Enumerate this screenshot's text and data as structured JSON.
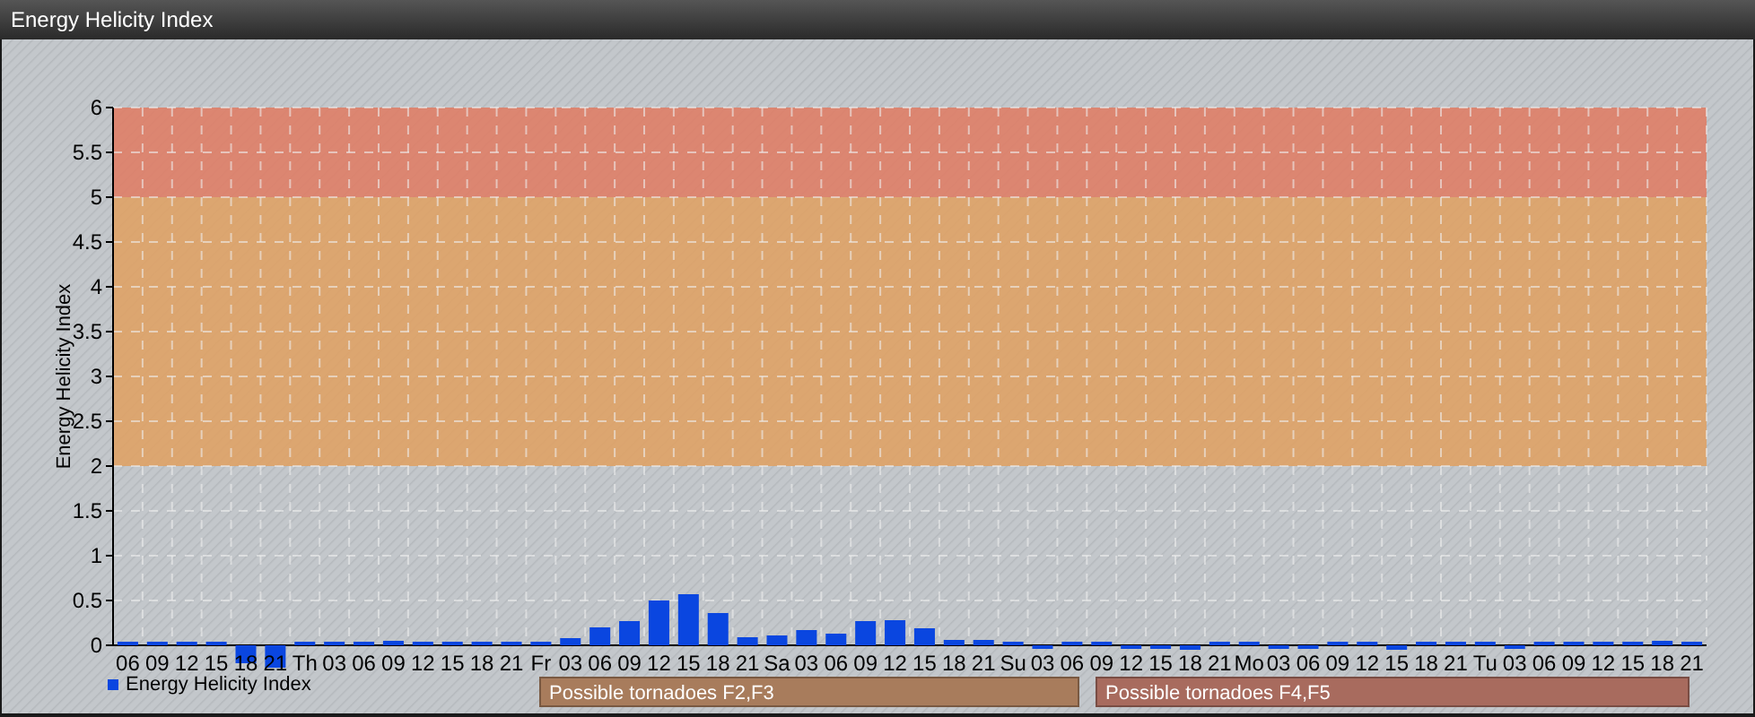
{
  "window": {
    "title": "Energy Helicity Index"
  },
  "chart": {
    "chart_data": {
      "type": "bar",
      "ylabel": "Energy Helicity Index",
      "ylim": [
        -0.3,
        6
      ],
      "grid": true,
      "yticks": [
        0,
        0.5,
        1,
        1.5,
        2,
        2.5,
        3,
        3.5,
        4,
        4.5,
        5,
        5.5,
        6
      ],
      "categories": [
        "06",
        "09",
        "12",
        "15",
        "18",
        "21",
        "Th",
        "03",
        "06",
        "09",
        "12",
        "15",
        "18",
        "21",
        "Fr",
        "03",
        "06",
        "09",
        "12",
        "15",
        "18",
        "21",
        "Sa",
        "03",
        "06",
        "09",
        "12",
        "15",
        "18",
        "21",
        "Su",
        "03",
        "06",
        "09",
        "12",
        "15",
        "18",
        "21",
        "Mo",
        "03",
        "06",
        "09",
        "12",
        "15",
        "18",
        "21",
        "Tu",
        "03",
        "06",
        "09",
        "12",
        "15",
        "18",
        "21"
      ],
      "series": [
        {
          "name": "Energy Helicity Index",
          "color": "#0a46e0",
          "values": [
            0.04,
            0.04,
            0.04,
            0.04,
            -0.2,
            -0.25,
            0.04,
            0.04,
            0.04,
            0.05,
            0.04,
            0.04,
            0.04,
            0.04,
            0.04,
            0.08,
            0.2,
            0.27,
            0.5,
            0.57,
            0.36,
            0.09,
            0.11,
            0.17,
            0.13,
            0.27,
            0.28,
            0.19,
            0.06,
            0.06,
            0.04,
            -0.04,
            0.04,
            0.04,
            -0.04,
            -0.04,
            -0.05,
            0.04,
            0.04,
            -0.04,
            -0.04,
            0.04,
            0.04,
            -0.05,
            0.04,
            0.04,
            0.04,
            -0.04,
            0.04,
            0.04,
            0.04,
            0.04,
            0.05,
            0.04
          ]
        }
      ],
      "bands": [
        {
          "axis": "y",
          "from": 2,
          "to": 5,
          "color": "#e0a060"
        },
        {
          "axis": "y",
          "from": 5,
          "to": 6,
          "color": "#e07a62"
        }
      ]
    },
    "zone_legend": [
      {
        "label": "Possible tornadoes F2,F3",
        "color": "#a87c5c"
      },
      {
        "label": "Possible tornadoes F4,F5",
        "color": "#a86b5e"
      }
    ]
  }
}
